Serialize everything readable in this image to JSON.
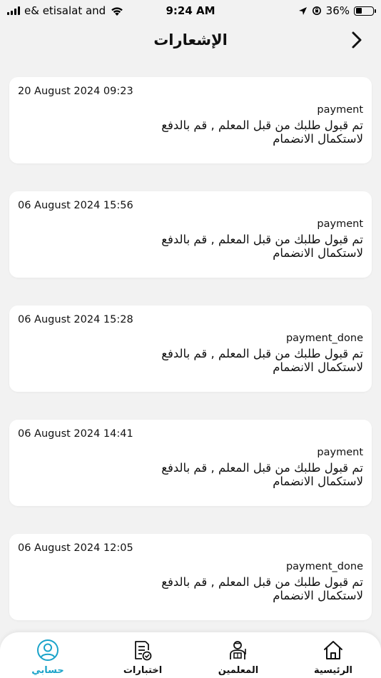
{
  "status_bar": {
    "carrier": "e& etisalat and",
    "time": "9:24 AM",
    "battery": "36%",
    "battery_level": 0.36
  },
  "header": {
    "title": "الإشعارات"
  },
  "notifications": [
    {
      "date": "20 August 2024 09:23",
      "type": "payment",
      "message": "تم قبول طلبك من قبل المعلم , قم بالدفع لاستكمال الانضمام"
    },
    {
      "date": "06 August 2024 15:56",
      "type": "payment",
      "message": "تم قبول طلبك من قبل المعلم , قم بالدفع لاستكمال الانضمام"
    },
    {
      "date": "06 August 2024 15:28",
      "type": "payment_done",
      "message": "تم قبول طلبك من قبل المعلم , قم بالدفع لاستكمال الانضمام"
    },
    {
      "date": "06 August 2024 14:41",
      "type": "payment",
      "message": "تم قبول طلبك من قبل المعلم , قم بالدفع لاستكمال الانضمام"
    },
    {
      "date": "06 August 2024 12:05",
      "type": "payment_done",
      "message": "تم قبول طلبك من قبل المعلم , قم بالدفع لاستكمال الانضمام"
    }
  ],
  "bottom_nav": {
    "items": [
      {
        "label": "حسابي",
        "icon": "user-icon",
        "active": true
      },
      {
        "label": "اختبارات",
        "icon": "exam-icon",
        "active": false
      },
      {
        "label": "المعلمين",
        "icon": "teacher-icon",
        "active": false
      },
      {
        "label": "الرئيسية",
        "icon": "home-icon",
        "active": false
      }
    ]
  },
  "colors": {
    "accent": "#1aa3c9",
    "background": "#f2f2f2",
    "card": "#ffffff"
  }
}
